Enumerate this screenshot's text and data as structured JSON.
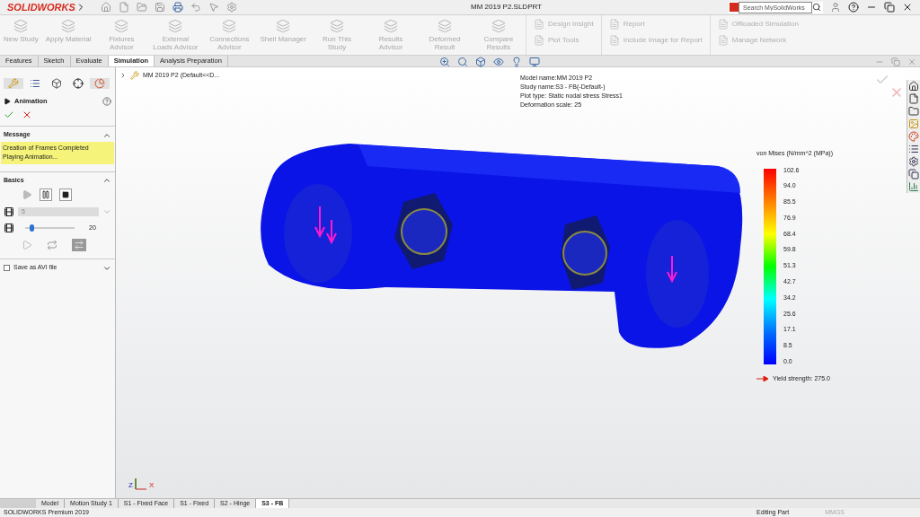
{
  "app": {
    "brand": "SOLIDWORKS",
    "title": "MM 2019 P2.SLDPRT",
    "search": {
      "placeholder": "Search MySolidWorks"
    }
  },
  "ribbon": [
    {
      "label": "New Study",
      "disabled": true
    },
    {
      "label": "Apply Material",
      "disabled": true
    },
    {
      "label": "Fixtures Advisor",
      "disabled": true
    },
    {
      "label": "External Loads Advisor",
      "disabled": true
    },
    {
      "label": "Connections Advisor",
      "disabled": true
    },
    {
      "label": "Shell Manager",
      "disabled": true
    },
    {
      "label": "Run This Study",
      "disabled": true
    },
    {
      "label": "Results Advisor",
      "disabled": true
    },
    {
      "label": "Deformed Result",
      "disabled": true
    },
    {
      "label": "Compare Results",
      "disabled": true
    }
  ],
  "ribbon_small": [
    [
      {
        "label": "Design Insight",
        "disabled": true
      },
      {
        "label": "Plot Tools",
        "disabled": true
      }
    ],
    [
      {
        "label": "Report",
        "disabled": true
      },
      {
        "label": "Include Image for Report",
        "disabled": true
      }
    ],
    [
      {
        "label": "Offloaded Simulation",
        "disabled": true
      },
      {
        "label": "Manage Network",
        "disabled": true
      }
    ]
  ],
  "tabs": [
    {
      "label": "Features",
      "selected": false
    },
    {
      "label": "Sketch",
      "selected": false
    },
    {
      "label": "Evaluate",
      "selected": false
    },
    {
      "label": "Simulation",
      "selected": true
    },
    {
      "label": "Analysis Preparation",
      "selected": false
    }
  ],
  "panel": {
    "title": "Animation",
    "message_heading": "Message",
    "message": [
      "Creation of Frames Completed",
      "Playing Animation..."
    ],
    "basics_heading": "Basics",
    "frames": "5",
    "speed": {
      "level": 0.1,
      "reading": "20"
    },
    "save_avi": {
      "label": "Save as AVI file",
      "checked": false
    }
  },
  "tree": {
    "label": "MM 2019 P2  (Default<<D..."
  },
  "plot_info": [
    "Model name:MM 2019 P2",
    "Study name:S3 - FB(-Default-)",
    "Plot type: Static nodal stress Stress1",
    "Deformation scale: 25"
  ],
  "legend": {
    "title": "von Mises (N/mm^2 (MPa))",
    "ticks": [
      "102.6",
      "94.0",
      "85.5",
      "76.9",
      "68.4",
      "59.8",
      "51.3",
      "42.7",
      "34.2",
      "25.6",
      "17.1",
      "8.5",
      "0.0"
    ],
    "yield": "Yield strength: 275.0"
  },
  "triad": [
    "Z",
    "X"
  ],
  "bottom_tabs": [
    {
      "label": "Model",
      "selected": false
    },
    {
      "label": "Motion Study 1",
      "selected": false
    },
    {
      "label": "S1 - Fixed Face",
      "selected": false
    },
    {
      "label": "S1 - Fixed",
      "selected": false
    },
    {
      "label": "S2 - Hinge",
      "selected": false
    },
    {
      "label": "S3 - FB",
      "selected": true
    }
  ],
  "status": {
    "product": "SOLIDWORKS Premium 2019",
    "mode": "Editing Part",
    "units": "MMGS"
  }
}
